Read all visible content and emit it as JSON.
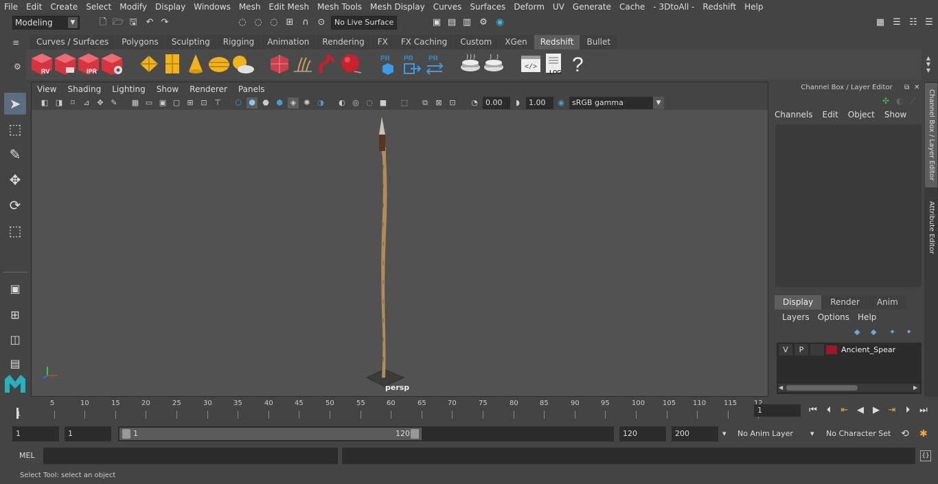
{
  "menubar": [
    "File",
    "Edit",
    "Create",
    "Select",
    "Modify",
    "Display",
    "Windows",
    "Mesh",
    "Edit Mesh",
    "Mesh Tools",
    "Mesh Display",
    "Curves",
    "Surfaces",
    "Deform",
    "UV",
    "Generate",
    "Cache",
    "- 3DtoAll -",
    "Redshift",
    "Help"
  ],
  "status": {
    "mode": "Modeling",
    "live_surface": "No Live Surface"
  },
  "shelf_tabs": [
    {
      "label": "Curves / Surfaces",
      "active": false
    },
    {
      "label": "Polygons",
      "active": false
    },
    {
      "label": "Sculpting",
      "active": false
    },
    {
      "label": "Rigging",
      "active": false
    },
    {
      "label": "Animation",
      "active": false
    },
    {
      "label": "Rendering",
      "active": false
    },
    {
      "label": "FX",
      "active": false
    },
    {
      "label": "FX Caching",
      "active": false
    },
    {
      "label": "Custom",
      "active": false
    },
    {
      "label": "XGen",
      "active": false
    },
    {
      "label": "Redshift",
      "active": true
    },
    {
      "label": "Bullet",
      "active": false
    }
  ],
  "shelf": {
    "rv": "RV",
    "ipr": "IPR",
    "pr": "PR",
    "log": ".LOG",
    "help": "?"
  },
  "viewport": {
    "menu": [
      "View",
      "Shading",
      "Lighting",
      "Show",
      "Renderer",
      "Panels"
    ],
    "exposure": "0.00",
    "gamma_value": "1.00",
    "color_space": "sRGB gamma",
    "camera": "persp"
  },
  "channel_box": {
    "title": "Channel Box / Layer Editor",
    "menu": [
      "Channels",
      "Edit",
      "Object",
      "Show"
    ]
  },
  "layer_editor": {
    "tabs": [
      {
        "label": "Display",
        "active": true
      },
      {
        "label": "Render",
        "active": false
      },
      {
        "label": "Anim",
        "active": false
      }
    ],
    "menu": [
      "Layers",
      "Options",
      "Help"
    ],
    "layers": [
      {
        "v": "V",
        "p": "P",
        "name": "Ancient_Spear",
        "color": "#a0142e"
      }
    ]
  },
  "side_tabs": [
    "Channel Box / Layer Editor",
    "Attribute Editor"
  ],
  "timeline": {
    "ticks": [
      "5",
      "10",
      "15",
      "20",
      "25",
      "30",
      "35",
      "40",
      "45",
      "50",
      "55",
      "60",
      "65",
      "70",
      "75",
      "80",
      "85",
      "90",
      "95",
      "100",
      "105",
      "110",
      "115",
      "12"
    ],
    "first_label": "1",
    "current_frame": "1"
  },
  "range": {
    "start": "1",
    "playback_start": "1",
    "slider_start": "1",
    "slider_end": "120",
    "playback_end": "120",
    "end": "200",
    "anim_layer": "No Anim Layer",
    "character_set": "No Character Set"
  },
  "command_line": {
    "language": "MEL"
  },
  "help_line": "Select Tool: select an object",
  "colors": {
    "accent": "#5b6c80",
    "redshift_red": "#d8343f",
    "shelf_yellow": "#f2b21b",
    "pr_blue": "#2e8fd8",
    "layer_color": "#a0142e"
  }
}
